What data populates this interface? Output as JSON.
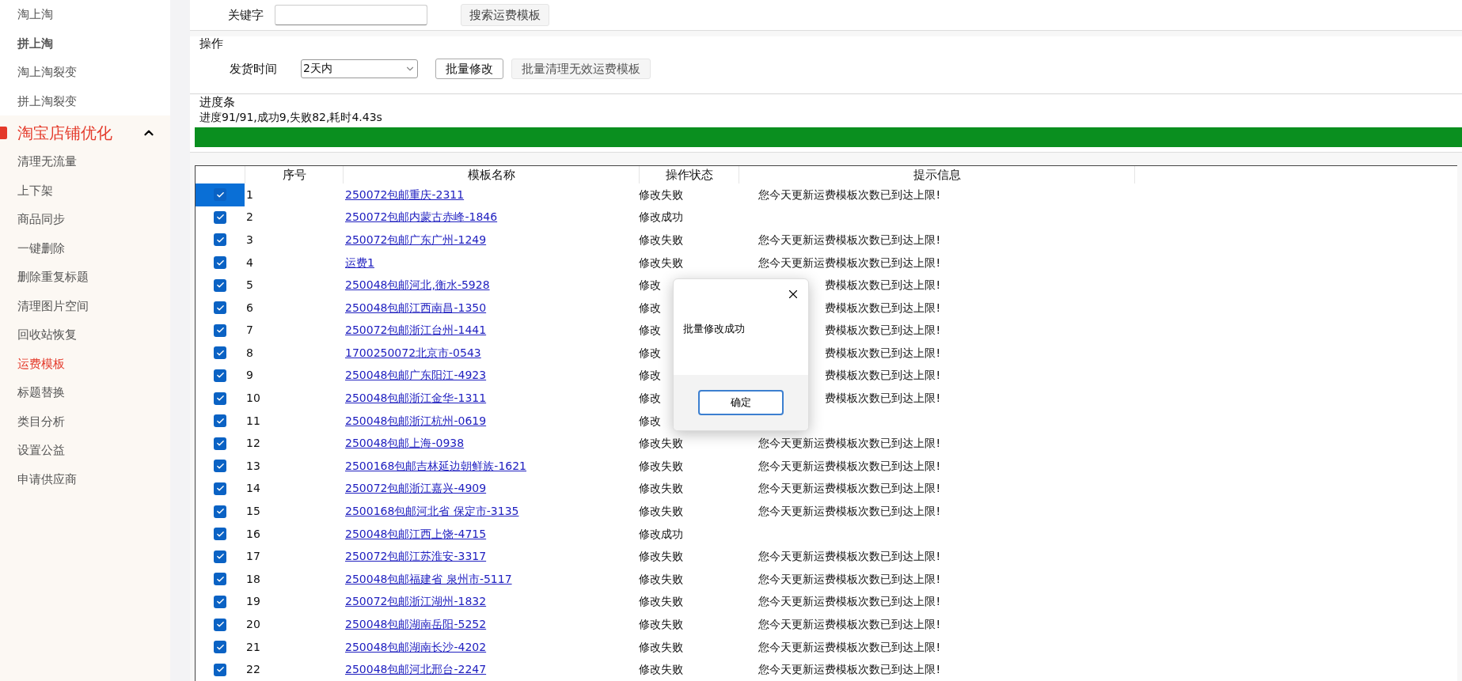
{
  "sidebar": {
    "items_top": [
      {
        "label": "淘上淘",
        "emphasized": false,
        "selected": false
      },
      {
        "label": "拼上淘",
        "emphasized": true,
        "selected": false
      },
      {
        "label": "淘上淘裂变",
        "emphasized": false,
        "selected": false
      },
      {
        "label": "拼上淘裂变",
        "emphasized": false,
        "selected": false
      }
    ],
    "section": {
      "title": "淘宝店铺优化",
      "expanded": true,
      "items": [
        {
          "label": "清理无流量",
          "emphasized": false,
          "selected": false
        },
        {
          "label": "上下架",
          "emphasized": false,
          "selected": false
        },
        {
          "label": "商品同步",
          "emphasized": false,
          "selected": false
        },
        {
          "label": "一键删除",
          "emphasized": false,
          "selected": false
        },
        {
          "label": "删除重复标题",
          "emphasized": false,
          "selected": false
        },
        {
          "label": "清理图片空间",
          "emphasized": false,
          "selected": false
        },
        {
          "label": "回收站恢复",
          "emphasized": false,
          "selected": false
        },
        {
          "label": "运费模板",
          "emphasized": false,
          "selected": true
        },
        {
          "label": "标题替换",
          "emphasized": false,
          "selected": false
        },
        {
          "label": "类目分析",
          "emphasized": false,
          "selected": false
        },
        {
          "label": "设置公益",
          "emphasized": false,
          "selected": false
        },
        {
          "label": "申请供应商",
          "emphasized": false,
          "selected": false
        }
      ]
    }
  },
  "search": {
    "label": "关键字",
    "button": "搜索运费模板"
  },
  "operation": {
    "title": "操作",
    "label": "发货时间",
    "select_value": "2天内",
    "buttons": [
      {
        "label": "批量修改",
        "disabled": false
      },
      {
        "label": "批量清理无效运费模板",
        "disabled": true
      }
    ]
  },
  "progress": {
    "title": "进度条",
    "text": "进度91/91,成功9,失败82,耗时4.43s",
    "level": 1
  },
  "table": {
    "columns": [
      "序号",
      "模板名称",
      "操作状态",
      "提示信息"
    ],
    "rows": [
      {
        "checked": true,
        "selected": true,
        "no": "1",
        "name": "250072包邮重庆-2311",
        "status": "修改失败",
        "message": "您今天更新运费模板次数已到达上限!"
      },
      {
        "checked": true,
        "selected": false,
        "no": "2",
        "name": "250072包邮内蒙古赤峰-1846",
        "status": "修改成功"
      },
      {
        "checked": true,
        "selected": false,
        "no": "3",
        "name": "250072包邮广东广州-1249",
        "status": "修改失败",
        "message": "您今天更新运费模板次数已到达上限!"
      },
      {
        "checked": true,
        "selected": false,
        "no": "4",
        "name": "运费1",
        "status": "修改失败",
        "message": "您今天更新运费模板次数已到达上限!"
      },
      {
        "checked": true,
        "selected": false,
        "no": "5",
        "name": "250048包邮河北,衡水-5928",
        "status": "修改",
        "message": "费模板次数已到达上限!"
      },
      {
        "checked": true,
        "selected": false,
        "no": "6",
        "name": "250048包邮江西南昌-1350",
        "status": "修改",
        "message": "费模板次数已到达上限!"
      },
      {
        "checked": true,
        "selected": false,
        "no": "7",
        "name": "250072包邮浙江台州-1441",
        "status": "修改",
        "message": "费模板次数已到达上限!"
      },
      {
        "checked": true,
        "selected": false,
        "no": "8",
        "name": "1700250072北京市-0543",
        "status": "修改",
        "message": "费模板次数已到达上限!"
      },
      {
        "checked": true,
        "selected": false,
        "no": "9",
        "name": "250048包邮广东阳江-4923",
        "status": "修改",
        "message": "费模板次数已到达上限!"
      },
      {
        "checked": true,
        "selected": false,
        "no": "10",
        "name": "250048包邮浙江金华-1311",
        "status": "修改",
        "message": "费模板次数已到达上限!"
      },
      {
        "checked": true,
        "selected": false,
        "no": "11",
        "name": "250048包邮浙江杭州-0619",
        "status": "修改"
      },
      {
        "checked": true,
        "selected": false,
        "no": "12",
        "name": "250048包邮上海-0938",
        "status": "修改失败",
        "message": "您今天更新运费模板次数已到达上限!"
      },
      {
        "checked": true,
        "selected": false,
        "no": "13",
        "name": "2500168包邮吉林延边朝鲜族-1621",
        "status": "修改失败",
        "message": "您今天更新运费模板次数已到达上限!"
      },
      {
        "checked": true,
        "selected": false,
        "no": "14",
        "name": "250072包邮浙江嘉兴-4909",
        "status": "修改失败",
        "message": "您今天更新运费模板次数已到达上限!"
      },
      {
        "checked": true,
        "selected": false,
        "no": "15",
        "name": "2500168包邮河北省 保定市-3135",
        "status": "修改失败",
        "message": "您今天更新运费模板次数已到达上限!"
      },
      {
        "checked": true,
        "selected": false,
        "no": "16",
        "name": "250048包邮江西上饶-4715",
        "status": "修改成功"
      },
      {
        "checked": true,
        "selected": false,
        "no": "17",
        "name": "250072包邮江苏淮安-3317",
        "status": "修改失败",
        "message": "您今天更新运费模板次数已到达上限!"
      },
      {
        "checked": true,
        "selected": false,
        "no": "18",
        "name": "250048包邮福建省 泉州市-5117",
        "status": "修改失败",
        "message": "您今天更新运费模板次数已到达上限!"
      },
      {
        "checked": true,
        "selected": false,
        "no": "19",
        "name": "250072包邮浙江湖州-1832",
        "status": "修改失败",
        "message": "您今天更新运费模板次数已到达上限!"
      },
      {
        "checked": true,
        "selected": false,
        "no": "20",
        "name": "250048包邮湖南岳阳-5252",
        "status": "修改失败",
        "message": "您今天更新运费模板次数已到达上限!"
      },
      {
        "checked": true,
        "selected": false,
        "no": "21",
        "name": "250048包邮湖南长沙-4202",
        "status": "修改失败",
        "message": "您今天更新运费模板次数已到达上限!"
      },
      {
        "checked": true,
        "selected": false,
        "no": "22",
        "name": "250048包邮河北邢台-2247",
        "status": "修改失败",
        "message": "您今天更新运费模板次数已到达上限!"
      }
    ]
  },
  "dialog": {
    "message": "批量修改成功",
    "button": "确定"
  }
}
